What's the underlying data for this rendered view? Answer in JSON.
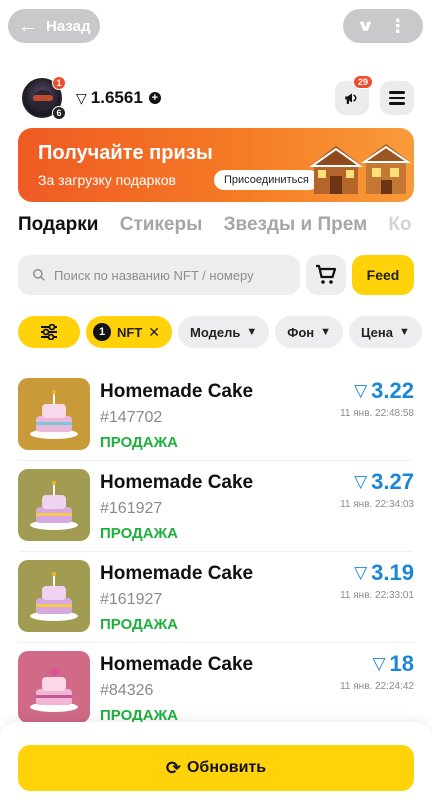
{
  "topbar": {
    "back_label": "Назад"
  },
  "profile": {
    "avatar_badge_top": "1",
    "avatar_badge_bottom": "6",
    "balance": "1.6561",
    "notifications_count": "29"
  },
  "banner": {
    "title": "Получайте призы",
    "subtitle": "За загрузку подарков",
    "join_label": "Присоединиться"
  },
  "tabs": [
    "Подарки",
    "Стикеры",
    "Звезды и Прем",
    "Ко"
  ],
  "search": {
    "placeholder": "Поиск по названию NFT / номеру",
    "feed_label": "Feed"
  },
  "filters": {
    "nft_count": "1",
    "nft_label": "NFT",
    "model_label": "Модель",
    "background_label": "Фон",
    "price_label": "Цена"
  },
  "items": [
    {
      "name": "Homemade Cake",
      "number": "#147702",
      "status": "ПРОДАЖА",
      "price": "3.22",
      "time": "11 янв. 22:48:58",
      "bg": "#c89a3a"
    },
    {
      "name": "Homemade Cake",
      "number": "#161927",
      "status": "ПРОДАЖА",
      "price": "3.27",
      "time": "11 янв. 22:34:03",
      "bg": "#a29b52"
    },
    {
      "name": "Homemade Cake",
      "number": "#161927",
      "status": "ПРОДАЖА",
      "price": "3.19",
      "time": "11 янв. 22:33:01",
      "bg": "#a29b52"
    },
    {
      "name": "Homemade Cake",
      "number": "#84326",
      "status": "ПРОДАЖА",
      "price": "18",
      "time": "11 янв. 22:24:42",
      "bg": "#d06a86"
    }
  ],
  "bottom": {
    "refresh_label": "Обновить"
  },
  "colors": {
    "accent": "#ffd20a",
    "price": "#1a86d8",
    "status": "#1db13d",
    "banner": "#ef5a24"
  }
}
